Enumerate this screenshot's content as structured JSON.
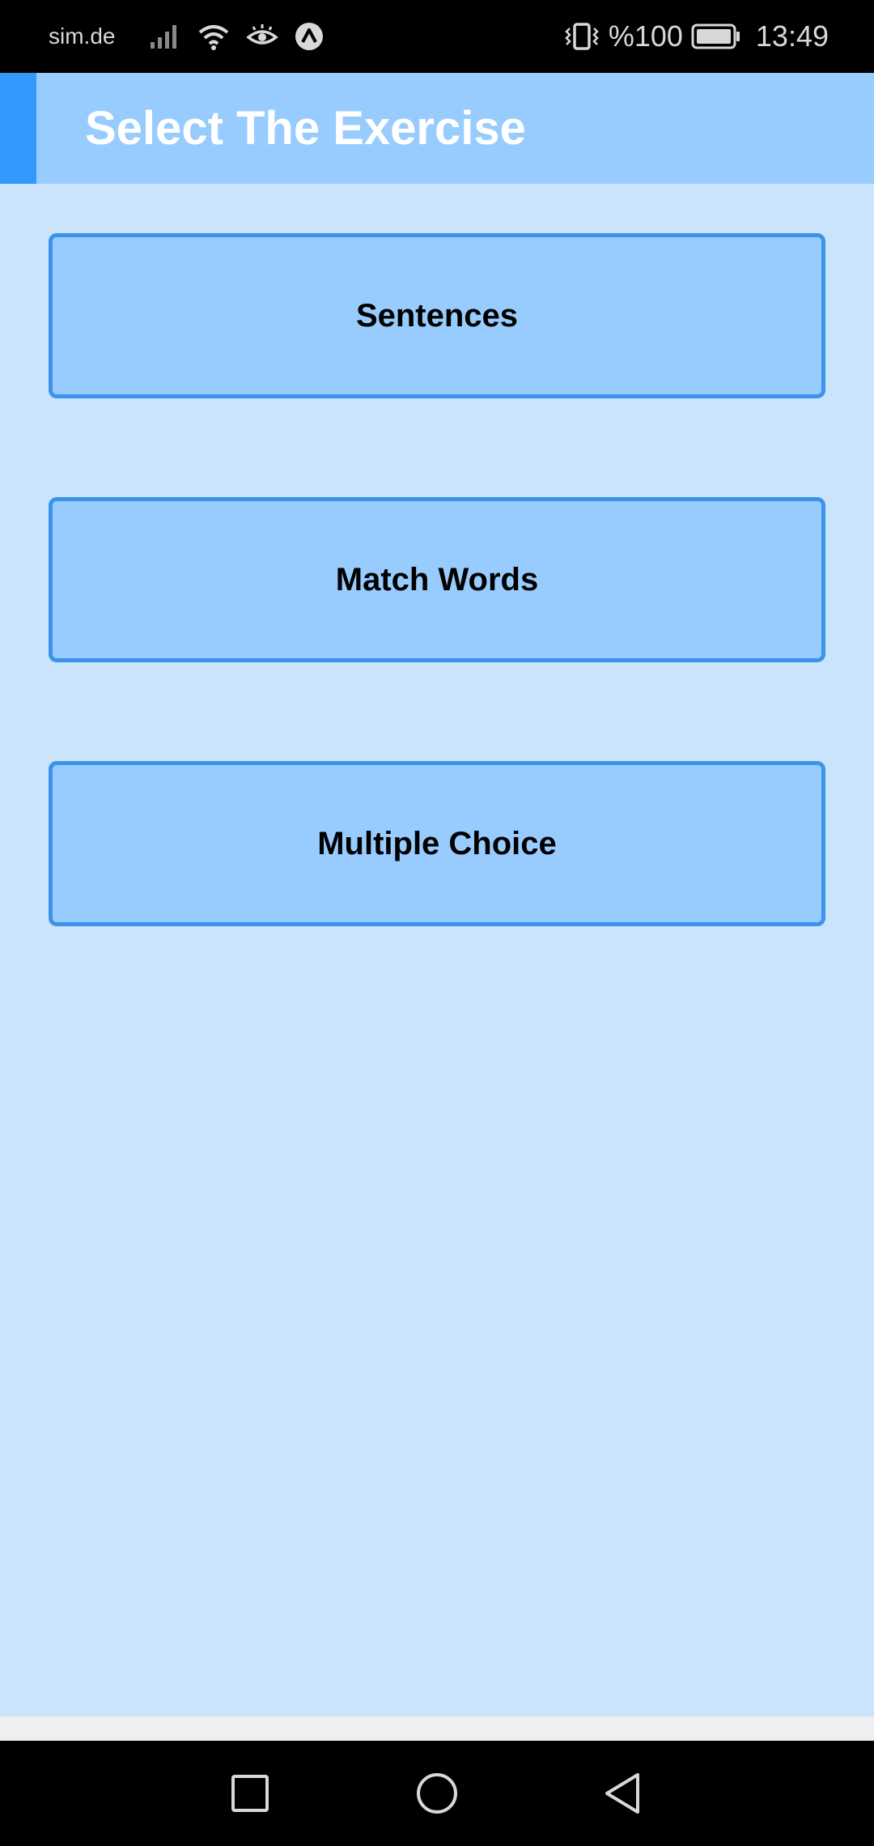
{
  "status_bar": {
    "carrier": "sim.de",
    "battery_percent": "%100",
    "time": "13:49",
    "icons": [
      "signal-icon",
      "wifi-icon",
      "eye-comfort-icon",
      "app-notification-icon",
      "vibrate-icon",
      "battery-icon"
    ]
  },
  "app_bar": {
    "title": "Select The Exercise",
    "accent_color": "#3399fe",
    "background_color": "#99ccfe"
  },
  "exercises": [
    {
      "label": "Sentences"
    },
    {
      "label": "Match Words"
    },
    {
      "label": "Multiple Choice"
    }
  ],
  "colors": {
    "page_background": "#cae4fc",
    "button_fill": "#99ccfe",
    "button_border": "#3d93e9"
  },
  "nav_bar": {
    "icons": [
      "recents-icon",
      "home-icon",
      "back-icon"
    ]
  }
}
